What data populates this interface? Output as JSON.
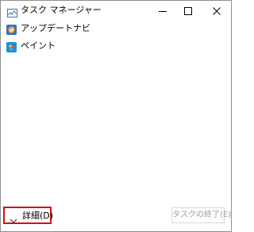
{
  "window": {
    "title": "タスク マネージャー"
  },
  "caption_buttons": {
    "minimize_icon": "minimize-icon",
    "maximize_icon": "maximize-icon",
    "close_icon": "close-icon"
  },
  "processes": [
    {
      "label": "アップデートナビ",
      "icon": "update-navi-icon"
    },
    {
      "label": "ペイント",
      "icon": "paint-icon"
    }
  ],
  "footer": {
    "details_label": "詳細(D)",
    "details_icon": "chevron-down-icon",
    "end_task_label": "タスクの終了(E)",
    "highlight_color": "#d0121b"
  }
}
